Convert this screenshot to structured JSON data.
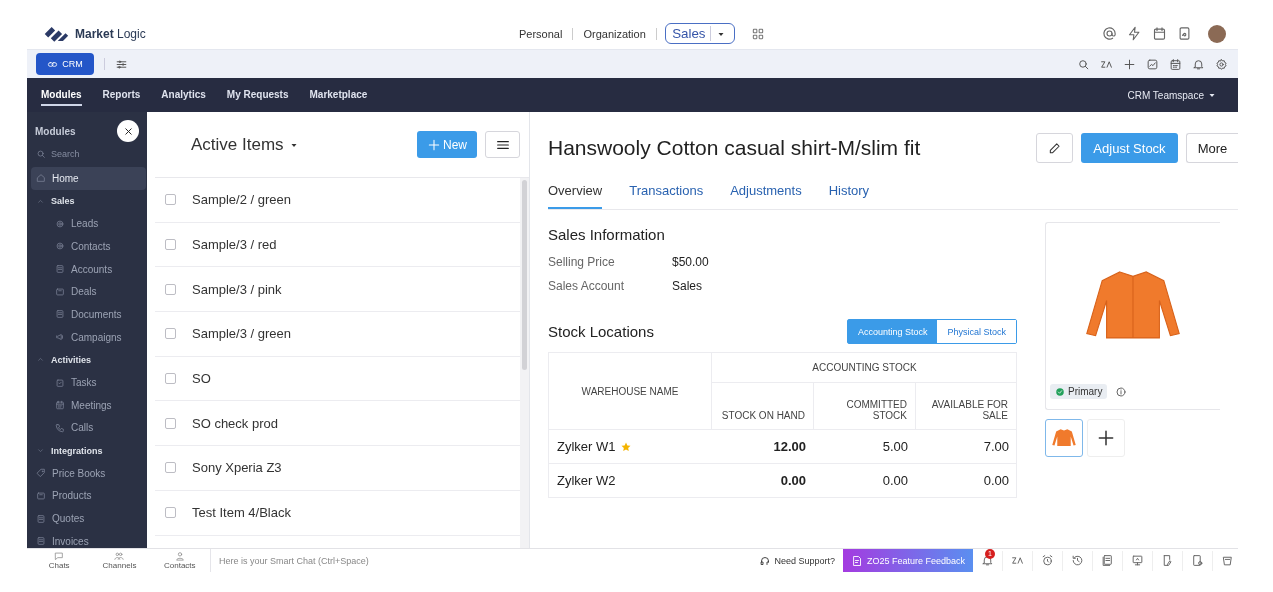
{
  "brand": {
    "name": "**Market** Logic"
  },
  "view_tabs": [
    {
      "label": "Personal",
      "selected": false
    },
    {
      "label": "Organization",
      "selected": false
    },
    {
      "label": "Sales",
      "selected": true
    }
  ],
  "toolbar": {
    "app_button": "CRM"
  },
  "nav": {
    "items": [
      {
        "label": "Modules",
        "selected": true
      },
      {
        "label": "Reports",
        "selected": false
      },
      {
        "label": "Analytics",
        "selected": false
      },
      {
        "label": "My Requests",
        "selected": false
      },
      {
        "label": "Marketplace",
        "selected": false
      }
    ],
    "teamspace": "CRM Teamspace"
  },
  "sidebar": {
    "title": "Modules",
    "search_placeholder": "Search",
    "items": [
      {
        "kind": "item",
        "label": "Home",
        "selected": true
      },
      {
        "kind": "group",
        "label": "Sales",
        "expanded": true,
        "children": [
          {
            "label": "Leads",
            "selected": false
          },
          {
            "label": "Contacts",
            "selected": false
          },
          {
            "label": "Accounts",
            "selected": false
          },
          {
            "label": "Deals",
            "selected": false
          },
          {
            "label": "Documents",
            "selected": false
          },
          {
            "label": "Campaigns",
            "selected": false
          }
        ]
      },
      {
        "kind": "group",
        "label": "Activities",
        "expanded": true,
        "children": [
          {
            "label": "Tasks",
            "selected": false
          },
          {
            "label": "Meetings",
            "selected": false
          },
          {
            "label": "Calls",
            "selected": false
          }
        ]
      },
      {
        "kind": "group",
        "label": "Integrations",
        "expanded": false
      },
      {
        "kind": "item",
        "label": "Price Books",
        "selected": false
      },
      {
        "kind": "item",
        "label": "Products",
        "selected": false
      },
      {
        "kind": "item",
        "label": "Quotes",
        "selected": false
      },
      {
        "kind": "item",
        "label": "Invoices",
        "selected": false
      }
    ]
  },
  "list": {
    "title": "Active Items",
    "new_button": "New",
    "items": [
      {
        "label": "Sample/2 / green",
        "checked": false
      },
      {
        "label": "Sample/3 / red",
        "checked": false
      },
      {
        "label": "Sample/3 / pink",
        "checked": false
      },
      {
        "label": "Sample/3 / green",
        "checked": false
      },
      {
        "label": "SO",
        "checked": false
      },
      {
        "label": "SO check prod",
        "checked": false
      },
      {
        "label": "Sony Xperia Z3",
        "checked": false
      },
      {
        "label": "Test Item 4/Black",
        "checked": false
      }
    ]
  },
  "detail": {
    "title": "Hanswooly Cotton casual shirt-M/slim fit",
    "primary_action": "Adjust Stock",
    "more": "More",
    "tabs": [
      {
        "label": "Overview",
        "selected": true
      },
      {
        "label": "Transactions",
        "selected": false
      },
      {
        "label": "Adjustments",
        "selected": false
      },
      {
        "label": "History",
        "selected": false
      }
    ],
    "sales_info": {
      "heading": "Sales Information",
      "fields": [
        {
          "label": "Selling Price",
          "value": "$50.00"
        },
        {
          "label": "Sales Account",
          "value": "Sales"
        }
      ]
    },
    "stock": {
      "heading": "Stock Locations",
      "toggle": [
        {
          "label": "Accounting Stock",
          "selected": true
        },
        {
          "label": "Physical Stock",
          "selected": false
        }
      ],
      "group_header": "ACCOUNTING STOCK",
      "columns": [
        "WAREHOUSE NAME",
        "STOCK ON HAND",
        "COMMITTED STOCK",
        "AVAILABLE FOR SALE"
      ],
      "rows": [
        {
          "starred": true,
          "cells": [
            "Zylker W1",
            "12.00",
            "5.00",
            "7.00"
          ]
        },
        {
          "starred": false,
          "cells": [
            "Zylker W2",
            "0.00",
            "0.00",
            "0.00"
          ]
        }
      ]
    },
    "image": {
      "badge": "Primary"
    }
  },
  "bottom_bar": {
    "tabs": [
      "Chats",
      "Channels",
      "Contacts"
    ],
    "chat_placeholder": "Here is your Smart Chat (Ctrl+Space)",
    "support": "Need Support?",
    "feedback": "ZO25 Feature Feedback",
    "notification_count": "1"
  }
}
